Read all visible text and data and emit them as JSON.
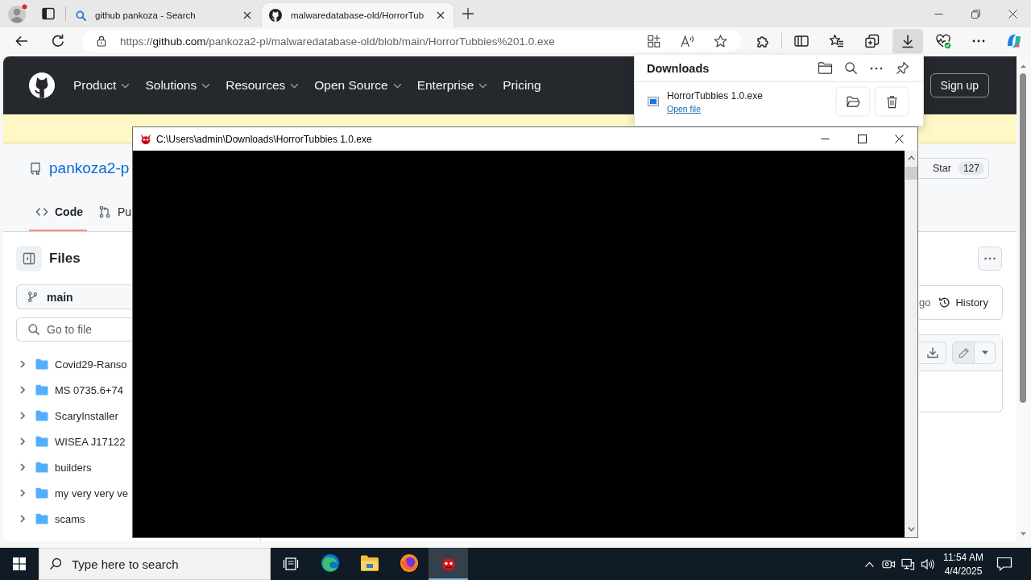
{
  "browser": {
    "tabs": [
      {
        "kind": "search",
        "title": "github pankoza - Search",
        "selected": false
      },
      {
        "kind": "site",
        "title": "malwaredatabase-old/HorrorTub",
        "selected": true
      }
    ],
    "address": {
      "scheme": "https://",
      "host": "github.com",
      "path": "/pankoza2-pl/malwaredatabase-old/blob/main/HorrorTubbies%201.0.exe"
    },
    "downloads": {
      "open": true,
      "title": "Downloads",
      "items": [
        {
          "name": "HorrorTubbies 1.0.exe",
          "action": "Open file"
        }
      ]
    }
  },
  "page": {
    "nav": [
      {
        "label": "Product",
        "dropdown": true
      },
      {
        "label": "Solutions",
        "dropdown": true
      },
      {
        "label": "Resources",
        "dropdown": true
      },
      {
        "label": "Open Source",
        "dropdown": true
      },
      {
        "label": "Enterprise",
        "dropdown": true
      },
      {
        "label": "Pricing",
        "dropdown": false
      }
    ],
    "sign_up": "Sign up",
    "repo_name": "pankoza2-p",
    "star": {
      "label": "Star",
      "count": "127"
    },
    "tabs": [
      {
        "kind": "code",
        "label": "Code",
        "selected": true
      },
      {
        "kind": "pulls",
        "label": "Pu",
        "selected": false
      }
    ],
    "files_title": "Files",
    "branch": "main",
    "file_search": {
      "placeholder": "Go to file"
    },
    "tree": [
      {
        "name": "Covid29-Ranso",
        "expanded": false
      },
      {
        "name": "MS 0735.6+74",
        "expanded": false
      },
      {
        "name": "ScaryInstaller",
        "expanded": false
      },
      {
        "name": "WISEA J17122",
        "expanded": false
      },
      {
        "name": "builders",
        "expanded": false
      },
      {
        "name": "my very very ve",
        "expanded": false
      },
      {
        "name": "scams",
        "expanded": false
      }
    ],
    "commit": {
      "age": "go",
      "history": "History"
    }
  },
  "console": {
    "title": "C:\\Users\\admin\\Downloads\\HorrorTubbies 1.0.exe"
  },
  "taskbar": {
    "search": {
      "placeholder": "Type here to search"
    },
    "apps": [
      {
        "kind": "edge",
        "selected": false
      },
      {
        "kind": "explorer",
        "selected": false
      },
      {
        "kind": "firefox",
        "selected": false
      },
      {
        "kind": "app",
        "selected": true
      }
    ],
    "time": "11:54 AM",
    "date": "4/4/2025"
  }
}
